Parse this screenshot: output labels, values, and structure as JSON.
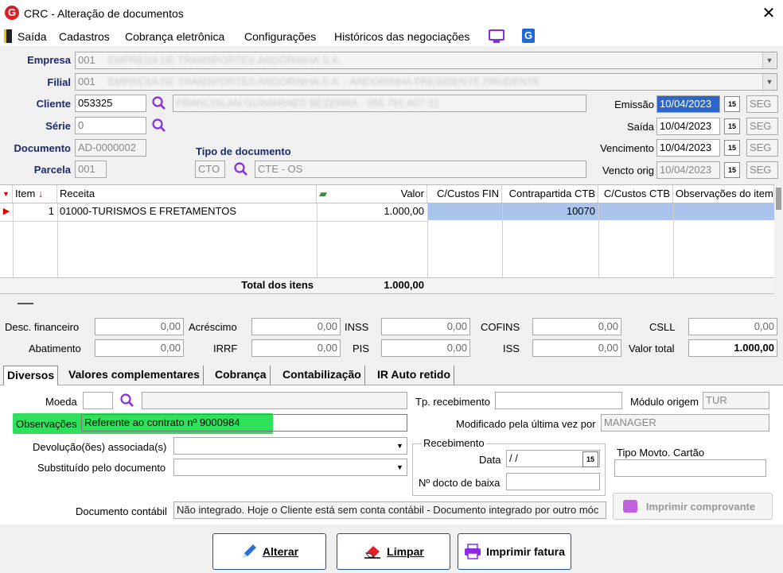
{
  "window": {
    "title": "CRC - Alteração de documentos"
  },
  "menu": {
    "items": [
      "Saída",
      "Cadastros",
      "Cobrança eletrônica",
      "Configurações",
      "Históricos das negociações"
    ]
  },
  "header": {
    "empresa_label": "Empresa",
    "empresa_code": "001",
    "empresa_name": "EMPRESA DE TRANSPORTES ANDORINHA S.A.",
    "filial_label": "Filial",
    "filial_code": "001",
    "filial_name": "EMPRESA DE TRANSPORTES ANDORINHA S.A. - ANDORINHA PRESIDENTE PRUDENTE",
    "cliente_label": "Cliente",
    "cliente_code": "053325",
    "cliente_name": "FRANCISLAN GUIMARAES BEZERRA - 056.791.467-31",
    "serie_label": "Série",
    "serie_value": "0",
    "documento_label": "Documento",
    "documento_value": "AD-0000002",
    "parcela_label": "Parcela",
    "parcela_value": "001",
    "tipo_doc_label": "Tipo de documento",
    "tipo_doc_code": "CTO",
    "tipo_doc_name": "CTE - OS",
    "emissao_label": "Emissão",
    "emissao_value": "10/04/2023",
    "emissao_day": "SEG",
    "saida_label": "Saída",
    "saida_value": "10/04/2023",
    "saida_day": "SEG",
    "vencimento_label": "Vencimento",
    "vencimento_value": "10/04/2023",
    "vencimento_day": "SEG",
    "vencto_orig_label": "Vencto orig",
    "vencto_orig_value": "10/04/2023",
    "vencto_orig_day": "SEG"
  },
  "grid": {
    "columns": [
      "Item",
      "Receita",
      "Valor",
      "C/Custos FIN",
      "Contrapartida CTB",
      "C/Custos CTB",
      "Observações do item"
    ],
    "rows": [
      {
        "item": "1",
        "receita": "01000-TURISMOS E FRETAMENTOS",
        "valor": "1.000,00",
        "ccustos_fin": "",
        "contrapartida": "10070",
        "ccustos_ctb": "",
        "obs": ""
      }
    ],
    "total_label": "Total dos itens",
    "total_value": "1.000,00"
  },
  "totals": {
    "desc_fin_label": "Desc. financeiro",
    "desc_fin": "0,00",
    "acrescimo_label": "Acréscimo",
    "acrescimo": "0,00",
    "inss_label": "INSS",
    "inss": "0,00",
    "cofins_label": "COFINS",
    "cofins": "0,00",
    "csll_label": "CSLL",
    "csll": "0,00",
    "abatimento_label": "Abatimento",
    "abatimento": "0,00",
    "irrf_label": "IRRF",
    "irrf": "0,00",
    "pis_label": "PIS",
    "pis": "0,00",
    "iss_label": "ISS",
    "iss": "0,00",
    "valor_total_label": "Valor total",
    "valor_total": "1.000,00"
  },
  "tabs": [
    "Diversos",
    "Valores complementares",
    "Cobrança",
    "Contabilização",
    "IR Auto retido"
  ],
  "diversos": {
    "moeda_label": "Moeda",
    "moeda_value": "",
    "obs_label": "Observações",
    "obs_value": "Referente ao contrato nº 9000984",
    "devolucao_label": "Devolução(ões) associada(s)",
    "substituido_label": "Substituído pelo documento",
    "tp_receb_label": "Tp. recebimento",
    "tp_receb_value": "",
    "modulo_label": "Módulo origem",
    "modulo_value": "TUR",
    "modificado_label": "Modificado pela última vez por",
    "modificado_value": "MANAGER",
    "recebimento_title": "Recebimento",
    "data_label": "Data",
    "data_value": "/ /",
    "docto_baixa_label": "Nº docto de baixa",
    "docto_baixa_value": "",
    "tipo_movto_label": "Tipo Movto. Cartão",
    "tipo_movto_value": "",
    "doc_contabil_label": "Documento contábil",
    "doc_contabil_value": "Não integrado. Hoje o Cliente está sem conta contábil - Documento integrado por outro móc",
    "imprimir_comprovante": "Imprimir comprovante"
  },
  "buttons": {
    "alterar": "Alterar",
    "limpar": "Limpar",
    "imprimir_fatura": "Imprimir fatura"
  },
  "colors": {
    "label_blue": "#1d2a6b",
    "highlight_green": "#2ee05a",
    "row_selected": "#aac4ee",
    "accent_purple": "#8a2be2"
  }
}
